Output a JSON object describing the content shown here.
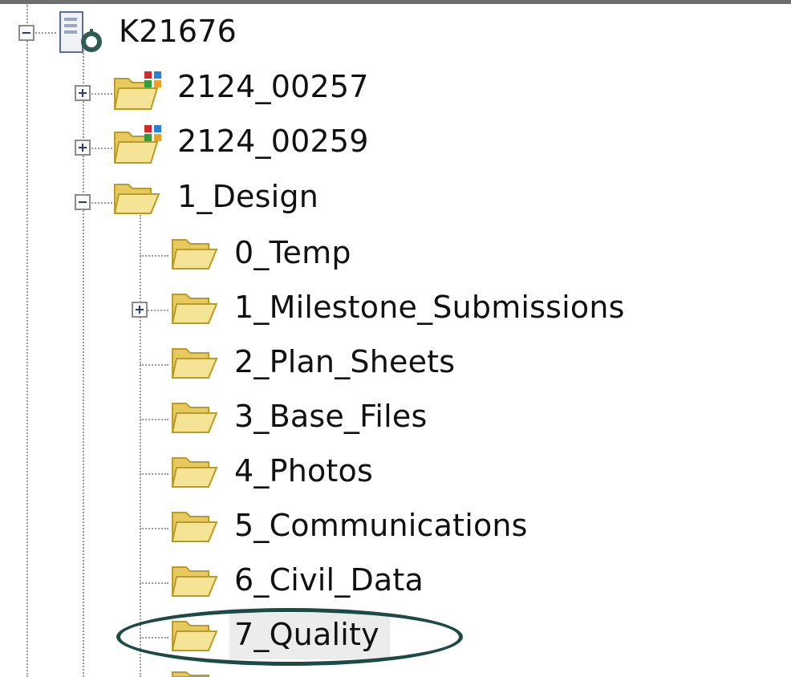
{
  "tree": {
    "root": {
      "label": "K21676",
      "icon": "datasource-icon",
      "expanded": true
    },
    "children": [
      {
        "label": "2124_00257",
        "icon": "project-folder-icon",
        "expandable": true,
        "expanded": false
      },
      {
        "label": "2124_00259",
        "icon": "project-folder-icon",
        "expandable": true,
        "expanded": false
      },
      {
        "label": "1_Design",
        "icon": "folder-icon",
        "expandable": true,
        "expanded": true,
        "children": [
          {
            "label": "0_Temp",
            "icon": "folder-icon",
            "expandable": false
          },
          {
            "label": "1_Milestone_Submissions",
            "icon": "folder-icon",
            "expandable": true,
            "expanded": false
          },
          {
            "label": "2_Plan_Sheets",
            "icon": "folder-icon",
            "expandable": false
          },
          {
            "label": "3_Base_Files",
            "icon": "folder-icon",
            "expandable": false
          },
          {
            "label": "4_Photos",
            "icon": "folder-icon",
            "expandable": false
          },
          {
            "label": "5_Communications",
            "icon": "folder-icon",
            "expandable": false
          },
          {
            "label": "6_Civil_Data",
            "icon": "folder-icon",
            "expandable": false
          },
          {
            "label": "7_Quality",
            "icon": "folder-icon",
            "expandable": false,
            "selected": true,
            "highlighted_with_ellipse": true
          }
        ]
      }
    ]
  },
  "colors": {
    "folder_fill": "#f2dd7a",
    "folder_edge": "#b99b2c",
    "connector": "#9a9a9a",
    "annotation_ellipse": "#1d4a45",
    "selection_bg": "#ececec"
  }
}
